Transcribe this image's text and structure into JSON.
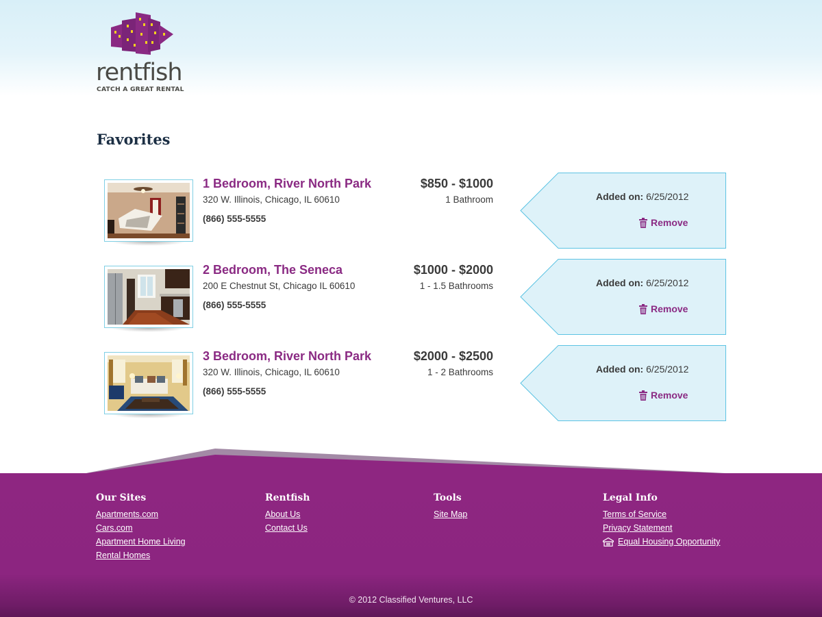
{
  "brand": {
    "name": "rentfish",
    "tagline": "CATCH A GREAT RENTAL"
  },
  "page": {
    "title": "Favorites"
  },
  "listings": [
    {
      "title": "1 Bedroom, River North Park",
      "address": "320 W. Illinois, Chicago, IL 60610",
      "phone": "(866) 555-5555",
      "price": "$850 - $1000",
      "baths": "1 Bathroom",
      "added_label": "Added on:",
      "added_date": "6/25/2012",
      "remove_label": "Remove",
      "photo": "bedroom"
    },
    {
      "title": "2 Bedroom, The Seneca",
      "address": "200 E Chestnut St, Chicago IL 60610",
      "phone": "(866) 555-5555",
      "price": "$1000 - $2000",
      "baths": "1 - 1.5 Bathrooms",
      "added_label": "Added on:",
      "added_date": "6/25/2012",
      "remove_label": "Remove",
      "photo": "kitchen"
    },
    {
      "title": "3 Bedroom, River North Park",
      "address": "320 W. Illinois, Chicago, IL 60610",
      "phone": "(866) 555-5555",
      "price": "$2000 - $2500",
      "baths": "1 - 2 Bathrooms",
      "added_label": "Added on:",
      "added_date": "6/25/2012",
      "remove_label": "Remove",
      "photo": "living-room"
    }
  ],
  "footer": {
    "columns": [
      {
        "heading": "Our Sites",
        "links": [
          "Apartments.com",
          "Cars.com",
          "Apartment Home Living",
          "Rental Homes"
        ]
      },
      {
        "heading": "Rentfish",
        "links": [
          "About Us",
          "Contact Us"
        ]
      },
      {
        "heading": "Tools",
        "links": [
          "Site Map"
        ]
      },
      {
        "heading": "Legal Info",
        "links": [
          "Terms of Service",
          "Privacy Statement",
          "Equal Housing Opportunity"
        ]
      }
    ],
    "copyright": "© 2012 Classified Ventures, LLC"
  },
  "icons": {
    "logo": "fish-building-icon",
    "remove": "trash-icon",
    "equal_housing": "equal-housing-icon"
  },
  "colors": {
    "brand_purple": "#8a2a83",
    "tag_fill": "#def2f9",
    "tag_border": "#5cc3e3",
    "title_navy": "#1c2f44"
  }
}
